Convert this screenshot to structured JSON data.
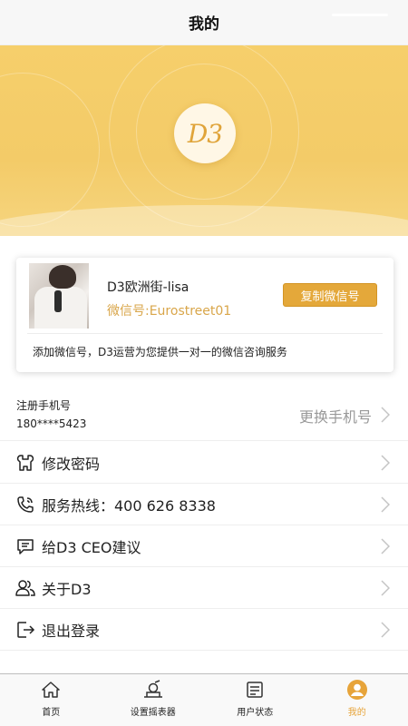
{
  "header": {
    "title": "我的"
  },
  "banner": {
    "logo_text": "D3"
  },
  "contact_card": {
    "name": "D3欧洲街-lisa",
    "wechat_id": "微信号:Eurostreet01",
    "copy_button": "复制微信号",
    "description": "添加微信号，D3运营为您提供一对一的微信咨询服务"
  },
  "phone": {
    "label": "注册手机号",
    "number": "180****5423",
    "change_label": "更换手机号"
  },
  "menu": [
    {
      "label": "修改密码",
      "icon": "password-icon"
    },
    {
      "label": "服务热线：400 626 8338",
      "icon": "hotline-icon"
    },
    {
      "label": "给D3 CEO建议",
      "icon": "feedback-icon"
    },
    {
      "label": "关于D3",
      "icon": "about-icon"
    },
    {
      "label": "退出登录",
      "icon": "logout-icon"
    }
  ],
  "tabbar": [
    {
      "label": "首页",
      "icon": "home-icon",
      "active": false
    },
    {
      "label": "设置摇表器",
      "icon": "shaker-icon",
      "active": false
    },
    {
      "label": "用户状态",
      "icon": "user-status-icon",
      "active": false
    },
    {
      "label": "我的",
      "icon": "profile-icon",
      "active": true
    }
  ],
  "colors": {
    "accent": "#e4a83a",
    "banner": "#f5cd6a",
    "wechat_text": "#d9a64a"
  }
}
